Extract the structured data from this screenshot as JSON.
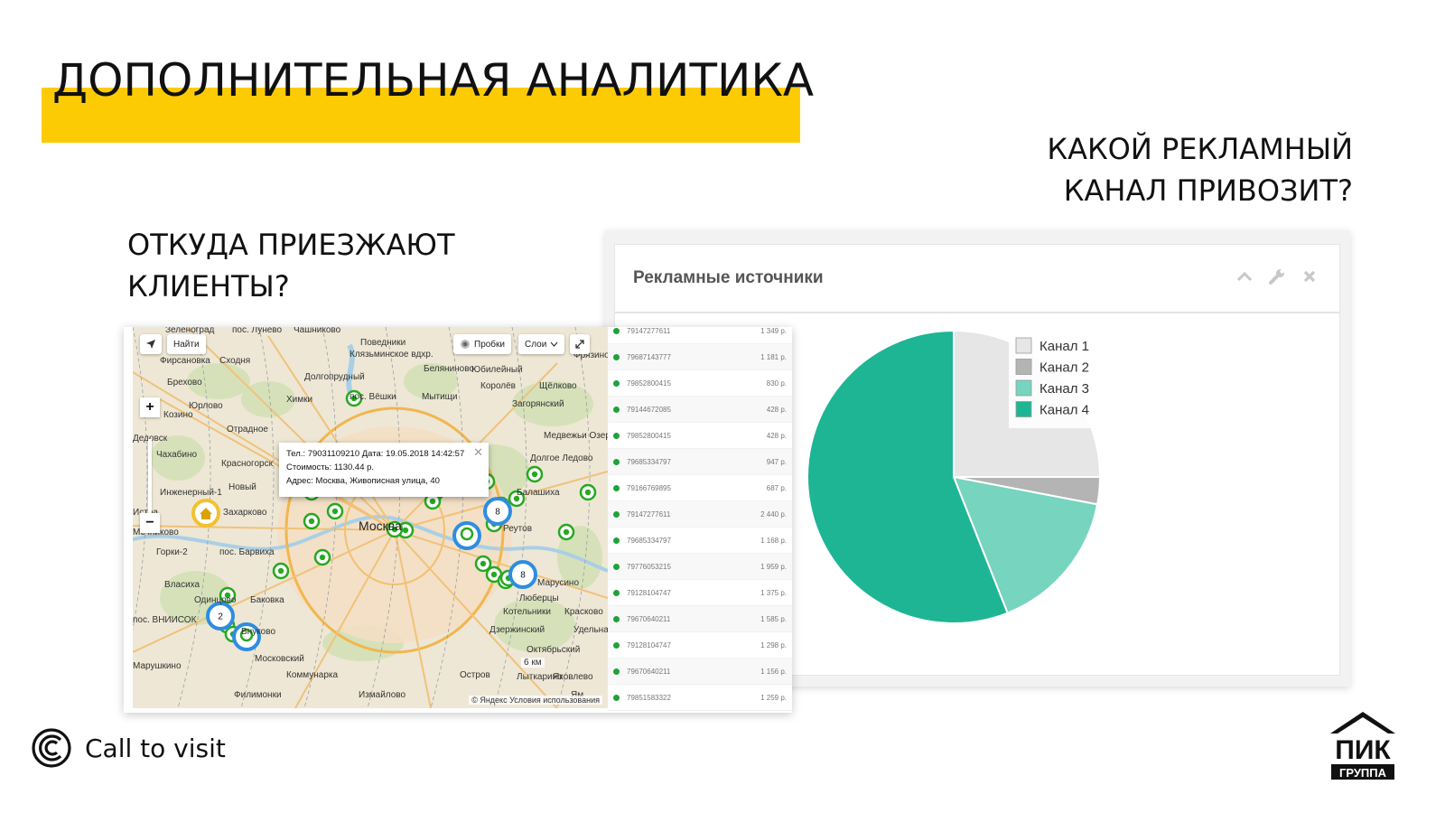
{
  "slide": {
    "title": "ДОПОЛНИТЕЛЬНАЯ АНАЛИТИКА",
    "accent_color": "#fdcb03",
    "question_right": [
      "КАКОЙ РЕКЛАМНЫЙ",
      "КАНАЛ ПРИВОЗИТ?"
    ],
    "question_left": [
      "ОТКУДА ПРИЕЗЖАЮТ",
      "КЛИЕНТЫ?"
    ]
  },
  "panel": {
    "title": "Рекламные источники",
    "tools": [
      {
        "icon": "chevron-up-icon",
        "glyph": "⌃"
      },
      {
        "icon": "wrench-icon",
        "glyph": "🔧"
      },
      {
        "icon": "close-icon",
        "glyph": "✕"
      }
    ]
  },
  "chart_data": {
    "type": "pie",
    "title": "",
    "legend": [
      "Канал 1",
      "Канал 2",
      "Канал 3",
      "Канал 4"
    ],
    "values": [
      25,
      3,
      16,
      56
    ],
    "colors": [
      "#e6e6e6",
      "#b4b4b4",
      "#77d4bf",
      "#1eb594"
    ],
    "legend_position": "top-right",
    "start_angle_deg": 0
  },
  "map": {
    "search_button": "Найти",
    "traffic_button": "Пробки",
    "layers_button": "Слои",
    "zoom_in": "+",
    "zoom_out": "−",
    "popup": {
      "line1": "Тел.: 79031109210 Дата: 19.05.2018 14:42:57",
      "line2": "Стоимость: 1130.44 р.",
      "line3": "Адрес: Москва, Живописная улица, 40"
    },
    "copyright": "© Яндекс Условия использования",
    "scale": "6 км",
    "place_labels": [
      {
        "t": "Зеленоград"
      },
      {
        "t": "пос. Лунево"
      },
      {
        "t": "Чашниково"
      },
      {
        "t": "Поведники"
      },
      {
        "t": "Фирсановка"
      },
      {
        "t": "Сходня"
      },
      {
        "t": "Клязьминское вдхр."
      },
      {
        "t": "Фрязино"
      },
      {
        "t": "Брехово"
      },
      {
        "t": "Долгопрудный"
      },
      {
        "t": "Беляниново"
      },
      {
        "t": "Юбилейный"
      },
      {
        "t": "Королёв"
      },
      {
        "t": "Щёлково"
      },
      {
        "t": "Юрлово"
      },
      {
        "t": "Химки"
      },
      {
        "t": "пос. Вёшки"
      },
      {
        "t": "Мытищи"
      },
      {
        "t": "Загорянский"
      },
      {
        "t": "Козино"
      },
      {
        "t": "Отрадное"
      },
      {
        "t": "Медвежьи Озера"
      },
      {
        "t": "Дедовск"
      },
      {
        "t": "Чахабино"
      },
      {
        "t": "Красногорск"
      },
      {
        "t": "Долгое Ледово"
      },
      {
        "t": "Инженерный-1"
      },
      {
        "t": "Новый"
      },
      {
        "t": "Балашиха"
      },
      {
        "t": "Истра"
      },
      {
        "t": "Захарково"
      },
      {
        "t": "Москва"
      },
      {
        "t": "Реутов"
      },
      {
        "t": "Мечниково"
      },
      {
        "t": "Горки-2"
      },
      {
        "t": "пос. Барвиха"
      },
      {
        "t": "Марусино"
      },
      {
        "t": "Власиха"
      },
      {
        "t": "Одинцово"
      },
      {
        "t": "Баковка"
      },
      {
        "t": "Люберцы"
      },
      {
        "t": "пос. ВНИИСОК"
      },
      {
        "t": "Котельники"
      },
      {
        "t": "Красково"
      },
      {
        "t": "Внуково"
      },
      {
        "t": "Дзержинский"
      },
      {
        "t": "Удельная"
      },
      {
        "t": "Марушкино"
      },
      {
        "t": "Московский"
      },
      {
        "t": "Октябрьский"
      },
      {
        "t": "Коммунарка"
      },
      {
        "t": "Остров"
      },
      {
        "t": "Лыткарино"
      },
      {
        "t": "Филимонки"
      },
      {
        "t": "Измайлово"
      },
      {
        "t": "Ям"
      },
      {
        "t": "Яковлево"
      }
    ],
    "clusters": [
      "8",
      "8",
      "2"
    ]
  },
  "calls": [
    {
      "phone": "79147277611",
      "price": "1 349 р."
    },
    {
      "phone": "79687143777",
      "price": "1 181 р."
    },
    {
      "phone": "79852800415",
      "price": "830 р."
    },
    {
      "phone": "79144672085",
      "price": "428 р."
    },
    {
      "phone": "79852800415",
      "price": "428 р."
    },
    {
      "phone": "79685334797",
      "price": "947 р."
    },
    {
      "phone": "79166769895",
      "price": "687 р."
    },
    {
      "phone": "79147277611",
      "price": "2 440 р."
    },
    {
      "phone": "79685334797",
      "price": "1 168 р."
    },
    {
      "phone": "79776053215",
      "price": "1 959 р."
    },
    {
      "phone": "79128104747",
      "price": "1 375 р."
    },
    {
      "phone": "79670640211",
      "price": "1 585 р."
    },
    {
      "phone": "79128104747",
      "price": "1 298 р."
    },
    {
      "phone": "79670640211",
      "price": "1 156 р."
    },
    {
      "phone": "79851583322",
      "price": "1 259 р."
    }
  ],
  "footer": {
    "brand_left": "Call to visit",
    "brand_right_top": "ПИК",
    "brand_right_bottom": "ГРУППА"
  }
}
